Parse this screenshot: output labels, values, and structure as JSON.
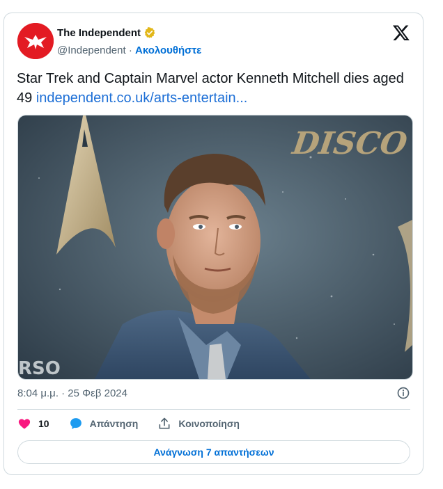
{
  "tweet": {
    "author_name": "The Independent",
    "handle": "@Independent",
    "separator": " · ",
    "follow_label": "Ακολουθήστε",
    "text": "Star Trek and Captain Marvel actor Kenneth Mitchell dies aged 49 ",
    "link_text": "independent.co.uk/arts-entertain...",
    "timestamp": "8:04 μ.μ. · 25 Φεβ 2024",
    "likes": "10",
    "reply_label": "Απάντηση",
    "share_label": "Κοινοποίηση",
    "read_replies_label": "Ανάγνωση 7 απαντήσεων"
  },
  "colors": {
    "accent_blue": "#006fd6",
    "like_pink": "#f91880",
    "brand_red": "#e31b23",
    "verified_gold": "#e2b719"
  },
  "icons": [
    "verified-badge-icon",
    "x-logo-icon",
    "info-icon",
    "heart-icon",
    "reply-bubble-icon",
    "share-icon"
  ]
}
